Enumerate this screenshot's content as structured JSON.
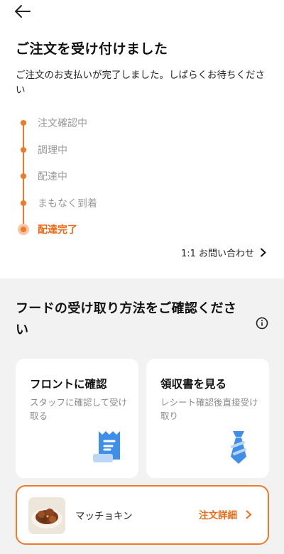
{
  "header": {
    "back_icon": "arrow-left-icon"
  },
  "status": {
    "title": "ご注文を受け付けました",
    "message": "ご注文のお支払いが完了しました。しばらくお待ちください"
  },
  "timeline": {
    "steps": [
      {
        "label": "注文確認中",
        "active": false
      },
      {
        "label": "調理中",
        "active": false
      },
      {
        "label": "配達中",
        "active": false
      },
      {
        "label": "まもなく到着",
        "active": false
      },
      {
        "label": "配達完了",
        "active": true
      }
    ],
    "accent_color": "#ef7a2a"
  },
  "inquiry": {
    "label": "1:1 お問い合わせ",
    "icon": "chevron-right-icon"
  },
  "pickup": {
    "title": "フードの受け取り方法をご確認ください",
    "info_icon": "info-icon",
    "options": [
      {
        "title": "フロントに確認",
        "description": "スタッフに確認して受け取る",
        "icon": "receipt-icon"
      },
      {
        "title": "領収書を見る",
        "description": "レシート確認後直接受け取り",
        "icon": "staff-tie-icon"
      }
    ]
  },
  "order": {
    "item_name": "マッチョキン",
    "detail_label": "注文詳細",
    "detail_icon": "chevron-right-icon"
  },
  "colors": {
    "accent": "#ef6a16",
    "icon_blue": "#3f8ee8",
    "section_bg": "#f2f2f2"
  }
}
